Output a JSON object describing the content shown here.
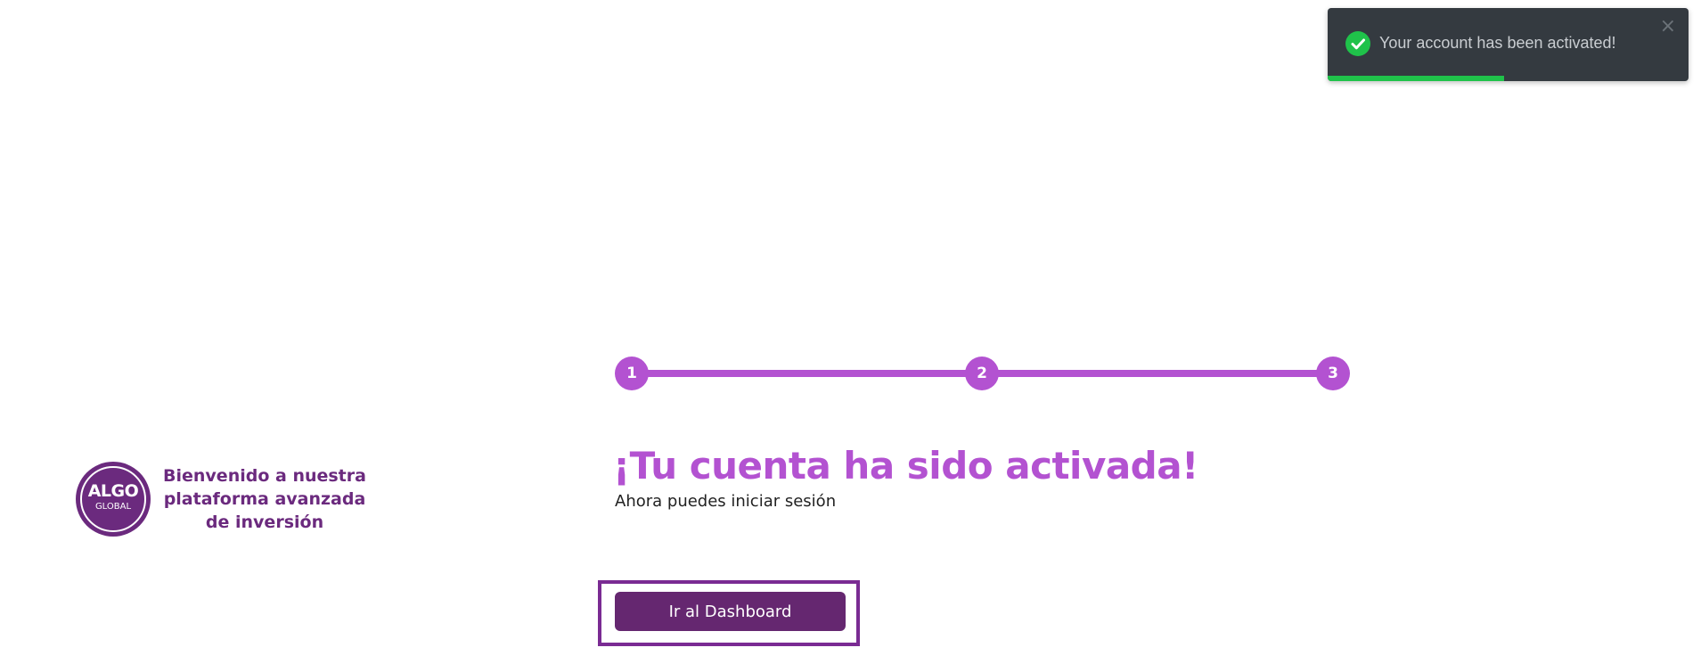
{
  "toast": {
    "message": "Your account has been activated!",
    "icon": "check-circle-icon",
    "close_glyph": "×",
    "progress": 0.49,
    "colors": {
      "background": "#343a40",
      "success": "#1fc24a"
    }
  },
  "brand": {
    "logo_line1": "ALGO",
    "logo_line2": "GLOBAL",
    "tagline": "Bienvenido a nuestra plataforma avanzada de inversión",
    "color": "#6b2a7e"
  },
  "stepper": {
    "steps": [
      "1",
      "2",
      "3"
    ],
    "current_step": 3,
    "color": "#b352d1"
  },
  "main": {
    "headline": "¡Tu cuenta ha sido activada!",
    "subline": "Ahora puedes iniciar sesión",
    "dashboard_button": "Ir al Dashboard"
  }
}
